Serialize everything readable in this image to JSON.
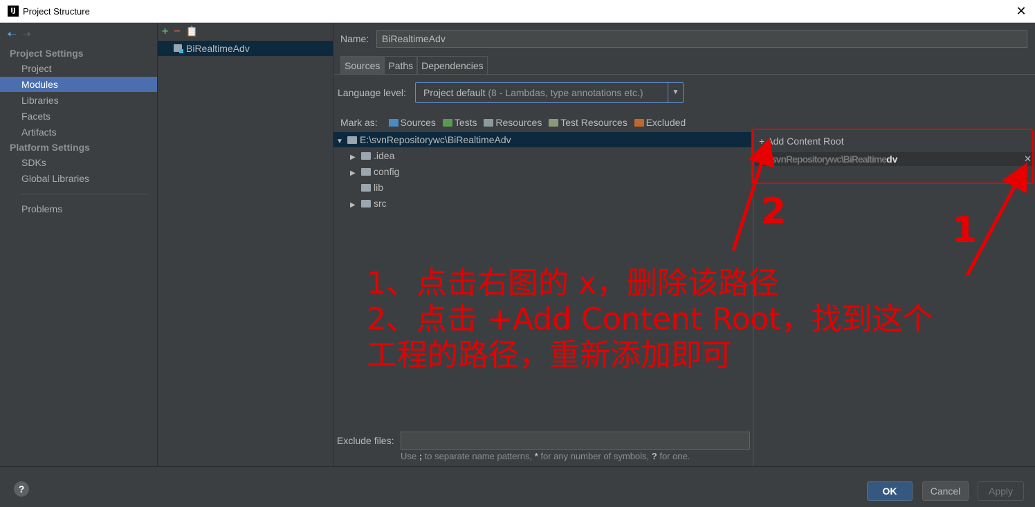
{
  "window": {
    "title": "Project Structure",
    "app_icon": "intellij-icon",
    "close_label": "✕"
  },
  "nav": {
    "back_icon": "back-arrow-icon",
    "forward_icon": "forward-arrow-icon",
    "project_settings_header": "Project Settings",
    "project_settings_items": [
      "Project",
      "Modules",
      "Libraries",
      "Facets",
      "Artifacts"
    ],
    "platform_settings_header": "Platform Settings",
    "platform_settings_items": [
      "SDKs",
      "Global Libraries"
    ],
    "problems": "Problems",
    "selected": "Modules"
  },
  "module_list": {
    "add": "+",
    "remove": "−",
    "copy_icon": "copy-icon",
    "modules": [
      "BiRealtimeAdv"
    ]
  },
  "detail": {
    "name_label": "Name:",
    "name_value": "BiRealtimeAdv",
    "tabs": [
      "Sources",
      "Paths",
      "Dependencies"
    ],
    "selected_tab": "Sources",
    "language_level_label": "Language level:",
    "language_level_main": "Project default",
    "language_level_sub": "(8 - Lambdas, type annotations etc.)",
    "mark_as_label": "Mark as:",
    "mark_as": [
      {
        "label": "Sources",
        "color": "#4a8bc4"
      },
      {
        "label": "Tests",
        "color": "#5a9a4e"
      },
      {
        "label": "Resources",
        "color": "#8a9a9e"
      },
      {
        "label": "Test Resources",
        "color": "#8a9a78"
      },
      {
        "label": "Excluded",
        "color": "#c2672b"
      }
    ],
    "tree": {
      "root": "E:\\svnRepositorywc\\BiRealtimeAdv",
      "children": [
        {
          "label": ".idea",
          "expandable": true
        },
        {
          "label": "config",
          "expandable": true
        },
        {
          "label": "lib",
          "expandable": false
        },
        {
          "label": "src",
          "expandable": true
        }
      ]
    },
    "content_root": {
      "add_label": "+ Add Content Root",
      "path_visible_start": "\\",
      "path_blurred": "svnRepositorywc\\BiRealtime",
      "path_visible_end": "dv",
      "remove": "✕"
    },
    "exclude_label": "Exclude files:",
    "exclude_value": "",
    "exclude_hint_pre": "Use ",
    "exclude_hint_b1": ";",
    "exclude_hint_mid1": " to separate name patterns, ",
    "exclude_hint_b2": "*",
    "exclude_hint_mid2": " for any number of symbols, ",
    "exclude_hint_b3": "?",
    "exclude_hint_post": " for one."
  },
  "buttons": {
    "help": "?",
    "ok": "OK",
    "cancel": "Cancel",
    "apply": "Apply"
  },
  "annotation": {
    "color": "#e60000",
    "num_1": "1",
    "num_2": "2",
    "line_1": "1、点击右图的 x，删除该路径",
    "line_2": "2、点击 +Add Content Root，找到这个",
    "line_3": "工程的路径，重新添加即可"
  }
}
